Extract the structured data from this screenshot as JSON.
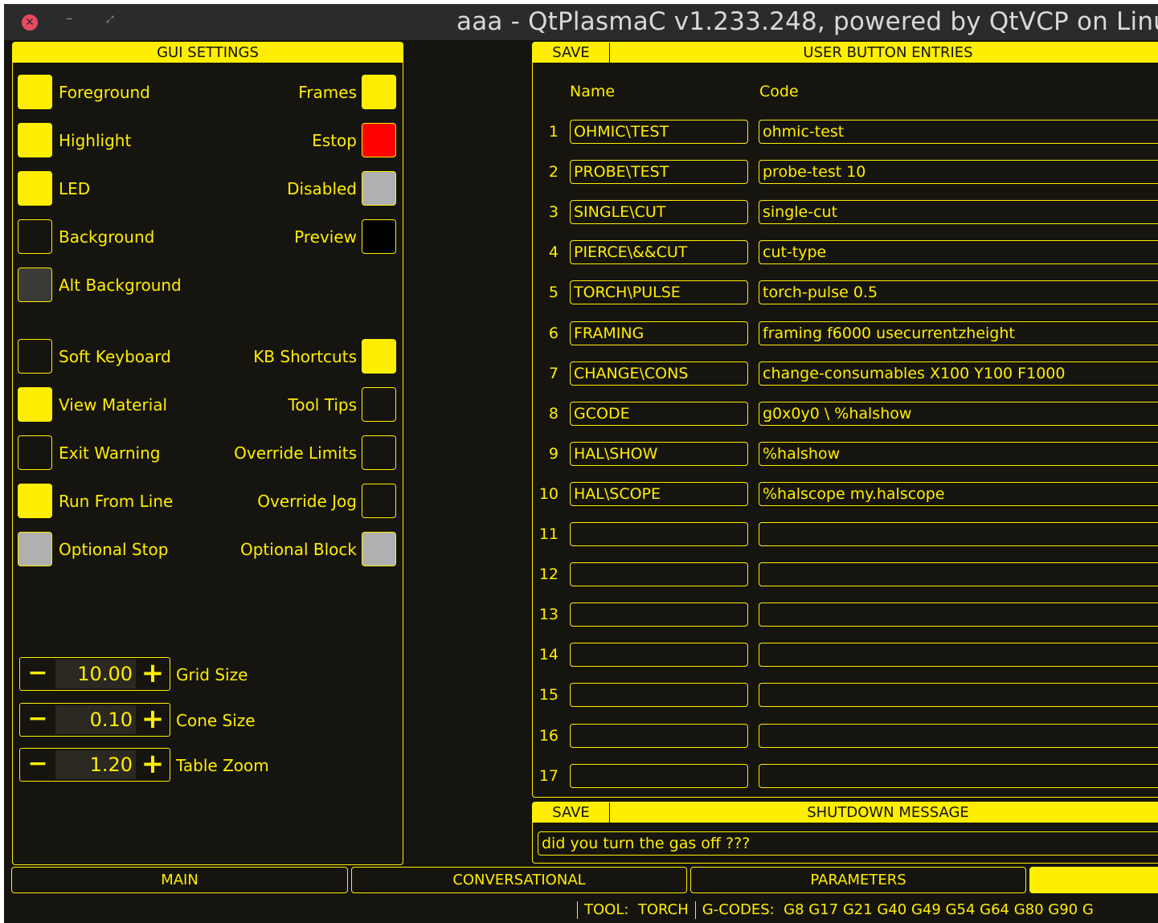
{
  "window": {
    "title": "aaa - QtPlasmaC v1.233.248, powered by QtVCP on Linu",
    "close_glyph": "✕",
    "minimize_glyph": "–",
    "maximize_glyph": "⤢"
  },
  "gui_settings": {
    "header": "GUI SETTINGS",
    "left_colors": [
      {
        "label": "Foreground",
        "color": "#ffee00"
      },
      {
        "label": "Highlight",
        "color": "#ffee00"
      },
      {
        "label": "LED",
        "color": "#ffee00"
      },
      {
        "label": "Background",
        "color": "#16140f"
      },
      {
        "label": "Alt Background",
        "color": "#3a3a36"
      }
    ],
    "right_colors": [
      {
        "label": "Frames",
        "color": "#ffee00"
      },
      {
        "label": "Estop",
        "color": "#ff0000"
      },
      {
        "label": "Disabled",
        "color": "#b0b0b0"
      },
      {
        "label": "Preview",
        "color": "#000000"
      }
    ],
    "left_options": [
      {
        "label": "Soft Keyboard",
        "checked": false,
        "color": "#16140f"
      },
      {
        "label": "View Material",
        "checked": true,
        "color": "#ffee00"
      },
      {
        "label": "Exit Warning",
        "checked": false,
        "color": "#16140f"
      },
      {
        "label": "Run From Line",
        "checked": true,
        "color": "#ffee00"
      },
      {
        "label": "Optional Stop",
        "checked": false,
        "disabled": true,
        "color": "#b0b0b0"
      }
    ],
    "right_options": [
      {
        "label": "KB Shortcuts",
        "checked": true,
        "color": "#ffee00"
      },
      {
        "label": "Tool Tips",
        "checked": false,
        "color": "#16140f"
      },
      {
        "label": "Override Limits",
        "checked": false,
        "color": "#16140f"
      },
      {
        "label": "Override Jog",
        "checked": false,
        "color": "#16140f"
      },
      {
        "label": "Optional Block",
        "checked": false,
        "disabled": true,
        "color": "#b0b0b0"
      }
    ],
    "spinners": [
      {
        "label": "Grid Size",
        "value": "10.00",
        "minus": "−",
        "plus": "+"
      },
      {
        "label": "Cone Size",
        "value": "0.10",
        "minus": "−",
        "plus": "+"
      },
      {
        "label": "Table Zoom",
        "value": "1.20",
        "minus": "−",
        "plus": "+"
      }
    ]
  },
  "user_buttons": {
    "save_label": "SAVE",
    "header": "USER BUTTON ENTRIES",
    "name_col": "Name",
    "code_col": "Code",
    "rows": [
      {
        "num": "1",
        "name": "OHMIC\\TEST",
        "code": "ohmic-test"
      },
      {
        "num": "2",
        "name": "PROBE\\TEST",
        "code": "probe-test 10"
      },
      {
        "num": "3",
        "name": "SINGLE\\CUT",
        "code": "single-cut"
      },
      {
        "num": "4",
        "name": "PIERCE\\&&CUT",
        "code": "cut-type"
      },
      {
        "num": "5",
        "name": "TORCH\\PULSE",
        "code": "torch-pulse 0.5"
      },
      {
        "num": "6",
        "name": "FRAMING",
        "code": "framing f6000 usecurrentzheight"
      },
      {
        "num": "7",
        "name": "CHANGE\\CONS",
        "code": "change-consumables X100 Y100 F1000"
      },
      {
        "num": "8",
        "name": "GCODE",
        "code": "g0x0y0 \\ %halshow"
      },
      {
        "num": "9",
        "name": "HAL\\SHOW",
        "code": "%halshow"
      },
      {
        "num": "10",
        "name": "HAL\\SCOPE",
        "code": "%halscope my.halscope"
      },
      {
        "num": "11",
        "name": "",
        "code": ""
      },
      {
        "num": "12",
        "name": "",
        "code": ""
      },
      {
        "num": "13",
        "name": "",
        "code": ""
      },
      {
        "num": "14",
        "name": "",
        "code": ""
      },
      {
        "num": "15",
        "name": "",
        "code": ""
      },
      {
        "num": "16",
        "name": "",
        "code": ""
      },
      {
        "num": "17",
        "name": "",
        "code": ""
      }
    ]
  },
  "shutdown": {
    "save_label": "SAVE",
    "header": "SHUTDOWN MESSAGE",
    "message": "did you turn the gas off ???"
  },
  "tabs": [
    {
      "label": "MAIN",
      "active": false
    },
    {
      "label": "CONVERSATIONAL",
      "active": false
    },
    {
      "label": "PARAMETERS",
      "active": false
    },
    {
      "label": "",
      "active": true
    }
  ],
  "status": {
    "tool_label": "TOOL:",
    "tool_value": "TORCH",
    "gcodes_label": "G-CODES:",
    "gcodes_value": "G8 G17 G21 G40 G49 G54 G64 G80 G90 G"
  },
  "colors": {
    "accent": "#ffee00",
    "background": "#16140f",
    "estop": "#ff0000"
  }
}
